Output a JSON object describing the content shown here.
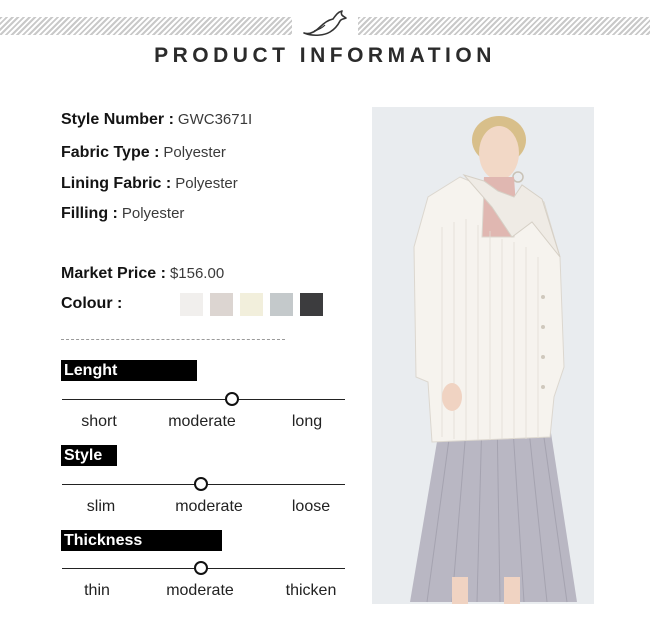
{
  "header": {
    "title": "PRODUCT INFORMATION"
  },
  "info": {
    "style_number": {
      "label": "Style Number :",
      "value": "GWC3671I"
    },
    "fabric_type": {
      "label": "Fabric Type :",
      "value": "Polyester"
    },
    "lining_fabric": {
      "label": "Lining Fabric :",
      "value": "Polyester"
    },
    "filling": {
      "label": "Filling :",
      "value": "Polyester"
    },
    "market_price": {
      "label": "Market Price :",
      "value": "$156.00"
    },
    "colour_label": "Colour :"
  },
  "colours": [
    "#f1efed",
    "#dcd5d1",
    "#f2efdc",
    "#c4c9cb",
    "#3c3c3e"
  ],
  "scales": {
    "length": {
      "label": "Lenght",
      "options": [
        "short",
        "moderate",
        "long"
      ],
      "selected": "moderate",
      "position": 0.6
    },
    "style": {
      "label": "Style",
      "options": [
        "slim",
        "moderate",
        "loose"
      ],
      "selected": "moderate",
      "position": 0.49
    },
    "thickness": {
      "label": "Thickness",
      "options": [
        "thin",
        "moderate",
        "thicken"
      ],
      "selected": "moderate",
      "position": 0.49
    }
  }
}
